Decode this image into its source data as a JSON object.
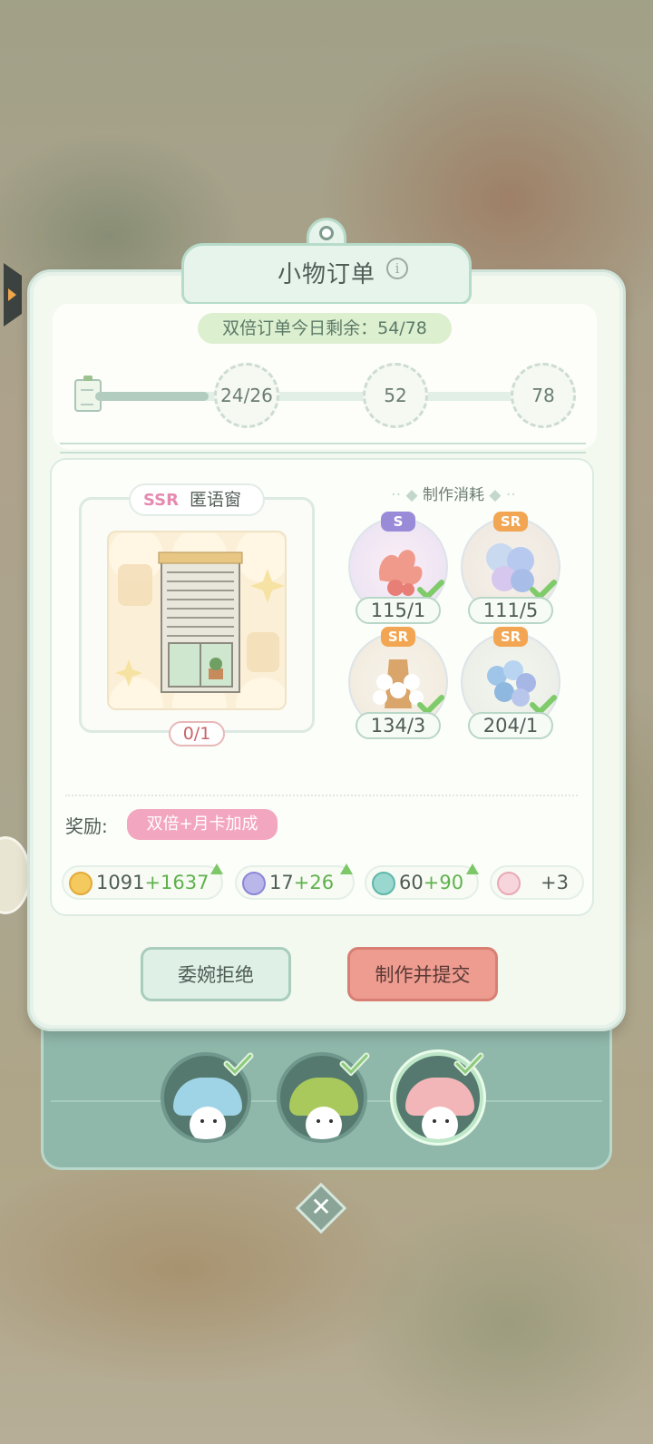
{
  "window": {
    "title": "小物订单",
    "info_icon": "info-icon"
  },
  "daily": {
    "double_orders_text": "双倍订单今日剩余：54/78"
  },
  "progress": {
    "current": 24,
    "fill_fraction": 0.24,
    "milestones": [
      "24/26",
      "52",
      "78"
    ]
  },
  "item": {
    "rarity": "SSR",
    "name": "匿语窗",
    "count": "0/1"
  },
  "cost": {
    "header": "制作消耗",
    "materials": [
      {
        "rarity": "S",
        "qty": "115/1",
        "color": "#9a8bd9",
        "icon": "pink-coral-icon"
      },
      {
        "rarity": "SR",
        "qty": "111/5",
        "color": "#f2a653",
        "icon": "blue-flower-ball-icon"
      },
      {
        "rarity": "SR",
        "qty": "134/3",
        "color": "#f2a653",
        "icon": "lily-basket-icon"
      },
      {
        "rarity": "SR",
        "qty": "204/1",
        "color": "#f2a653",
        "icon": "blue-bouquet-icon"
      }
    ]
  },
  "reward": {
    "label": "奖励:",
    "bonus_tag": "双倍+月卡加成",
    "items": [
      {
        "base": "1091",
        "bonus": "+1637",
        "icon": "coin-icon"
      },
      {
        "base": "17",
        "bonus": "+26",
        "icon": "token-icon"
      },
      {
        "base": "60",
        "bonus": "+90",
        "icon": "exp-icon"
      },
      {
        "base": "+3",
        "bonus": "",
        "icon": "gift-icon"
      }
    ]
  },
  "buttons": {
    "decline": "委婉拒绝",
    "make_submit": "制作并提交"
  },
  "close": {
    "label": "✕"
  },
  "colors": {
    "accent_green": "#5fb14e",
    "button_red": "#ee9c90",
    "panel_bg": "#f4f9f0"
  }
}
